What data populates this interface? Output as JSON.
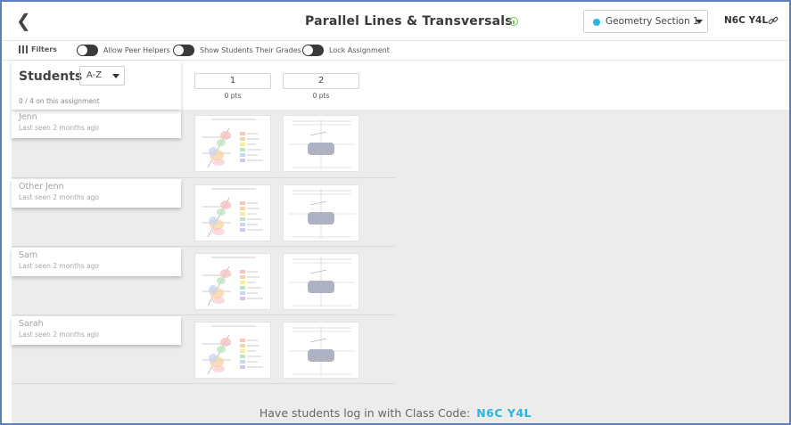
{
  "header": {
    "back_icon": "chevron-left-icon",
    "title": "Parallel Lines & Transversals",
    "section": {
      "label": "Geometry Section 1",
      "dot_color": "#29b6e0"
    },
    "class_code": "N6C Y4L"
  },
  "filterbar": {
    "filters_label": "Filters",
    "toggles": [
      {
        "label": "Allow Peer Helpers",
        "on": false
      },
      {
        "label": "Show Students Their Grades",
        "on": false
      },
      {
        "label": "Lock Assignment",
        "on": false
      }
    ]
  },
  "students_panel": {
    "title": "Students",
    "sort": "A-Z",
    "count_text": "0 / 4 on this assignment"
  },
  "questions": [
    {
      "number": "1",
      "points": "0 pts"
    },
    {
      "number": "2",
      "points": "0 pts"
    }
  ],
  "students": [
    {
      "name": "Jenn",
      "last_seen": "Last seen 2 months ago"
    },
    {
      "name": "Other Jenn",
      "last_seen": "Last seen 2 months ago"
    },
    {
      "name": "Sam",
      "last_seen": "Last seen 2 months ago"
    },
    {
      "name": "Sarah",
      "last_seen": "Last seen 2 months ago"
    }
  ],
  "footer": {
    "message": "Have students log in with Class Code:",
    "code": "N6C Y4L"
  },
  "colors": {
    "accent": "#29b6e0",
    "info": "#7ac05c",
    "frame": "#5b7fbf"
  }
}
